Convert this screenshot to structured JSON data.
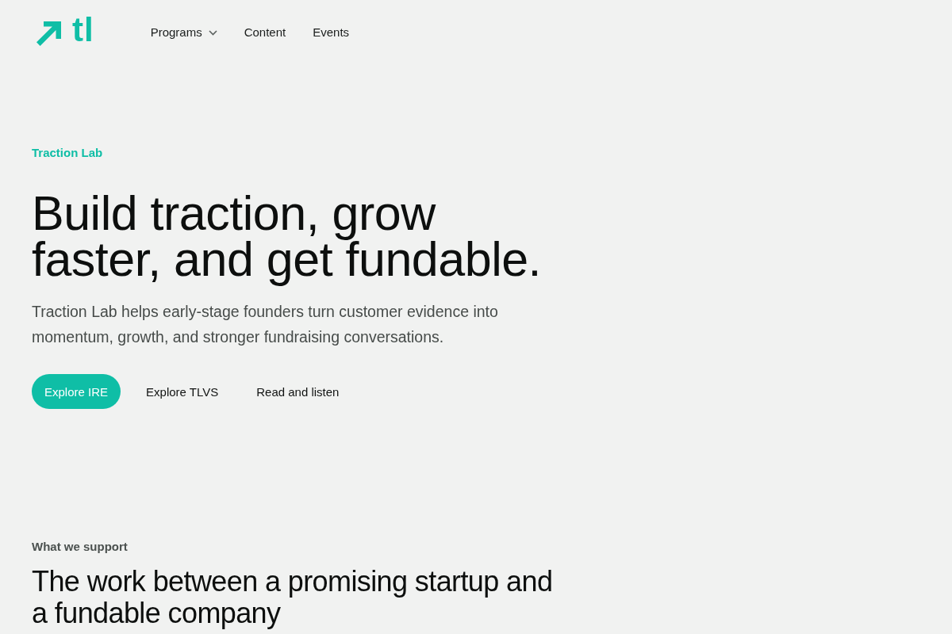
{
  "header": {
    "logo": {
      "text": "tl"
    },
    "nav": [
      {
        "label": "Programs",
        "has_dropdown": true
      },
      {
        "label": "Content",
        "has_dropdown": false
      },
      {
        "label": "Events",
        "has_dropdown": false
      }
    ]
  },
  "hero": {
    "eyebrow": "Traction Lab",
    "title": "Build traction, grow faster, and get fundable.",
    "description": "Traction Lab helps early-stage founders turn customer evidence into momentum, growth, and stronger fundraising conversations.",
    "buttons": [
      {
        "label": "Explore IRE",
        "kind": "primary"
      },
      {
        "label": "Explore TLVS",
        "kind": "text"
      },
      {
        "label": "Read and listen",
        "kind": "text"
      }
    ]
  },
  "support": {
    "eyebrow": "What we support",
    "title": "The work between a promising startup and a fundable company"
  }
}
